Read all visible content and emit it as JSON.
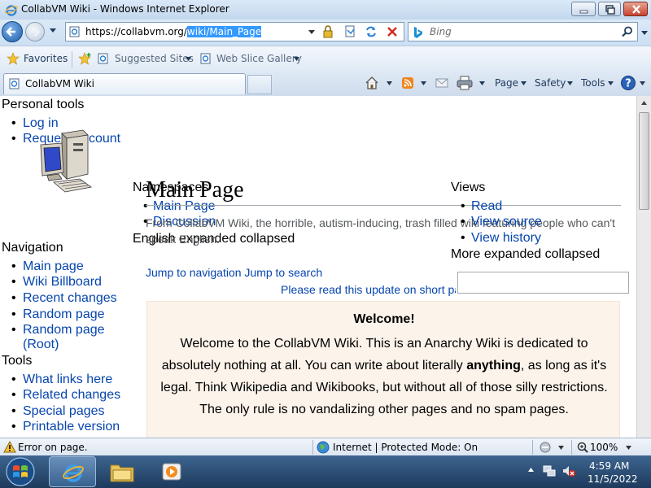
{
  "window": {
    "title": "CollabVM Wiki - Windows Internet Explorer"
  },
  "address": {
    "url_prefix": "https://collabvm.org/",
    "url_selected": "wiki/Main_Page"
  },
  "search": {
    "placeholder": "Bing"
  },
  "favorites": {
    "label": "Favorites",
    "suggested_sites": "Suggested Sites",
    "web_slice": "Web Slice Gallery"
  },
  "tab": {
    "label": "CollabVM Wiki"
  },
  "commands": {
    "page": "Page",
    "safety": "Safety",
    "tools": "Tools"
  },
  "wiki": {
    "personal_tools": {
      "heading": "Personal tools",
      "items": [
        "Log in",
        "Request account"
      ]
    },
    "namespaces": {
      "heading": "Namespaces",
      "items": [
        "Main Page",
        "Discussion"
      ],
      "variant": "English expanded collapsed"
    },
    "views": {
      "heading": "Views",
      "items": [
        "Read",
        "View source",
        "View history"
      ],
      "more": "More expanded collapsed"
    },
    "page_title": "Main Page",
    "tagline": "From CollabVM Wiki, the horrible, autism-inducing, trash filled wiki featuring people who can't speak English.",
    "jump_links": "Jump to navigation Jump to search",
    "notice": "Please read this update on short pages.",
    "navigation": {
      "heading": "Navigation",
      "items": [
        "Main page",
        "Wiki Billboard",
        "Recent changes",
        "Random page",
        "Random page",
        "(Root)"
      ]
    },
    "tools": {
      "heading": "Tools",
      "items": [
        "What links here",
        "Related changes",
        "Special pages",
        "Printable version"
      ]
    },
    "welcome": {
      "title": "Welcome!",
      "text_before": "Welcome to the CollabVM Wiki. This is an Anarchy Wiki is dedicated to absolutely nothing at all. You can write about literally ",
      "text_bold": "anything",
      "text_after": ", as long as it's legal. Think Wikipedia and Wikibooks, but without all of those silly restrictions. The only rule is no vandalizing other pages and no spam pages."
    }
  },
  "status": {
    "message": "Error on page.",
    "zone": "Internet | Protected Mode: On",
    "zoom": "100%"
  },
  "clock": {
    "time": "4:59 AM",
    "date": "11/5/2022"
  }
}
